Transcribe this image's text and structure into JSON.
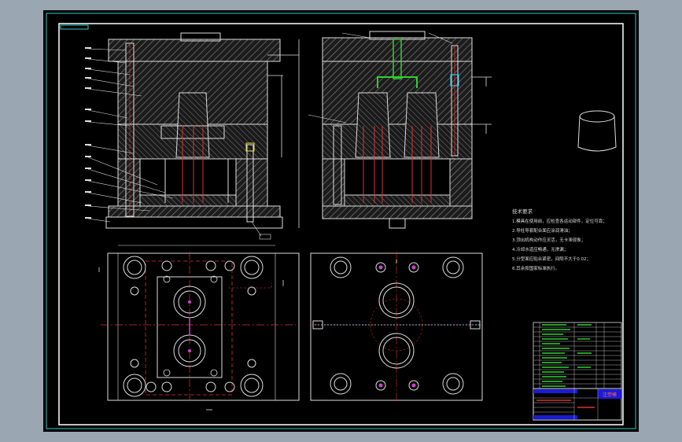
{
  "colors": {
    "outer": "#9aa6b1",
    "sheet": "#000000",
    "border": "#ffffff",
    "frame_cyan": "#35c8c8",
    "hatch": "#9a9a9a",
    "red": "#e03030",
    "green": "#30d030",
    "yellow": "#e8e030",
    "cyan": "#30c0e0",
    "magenta": "#d040d0",
    "blue_block": "#1a1ad8"
  },
  "drawing": {
    "tech_notes": [
      "技术要求",
      "1.模具在使用前，应检查各运动部件，定位可靠；",
      "2.导柱导套配合面应涂润滑油；",
      "3.顶出机构动作应灵活，无卡滞现象；",
      "4.冷却水道应畅通，无渗漏；",
      "5.分型面应贴合紧密，间隙不大于0.02；",
      "6.其余按国家标准执行。"
    ],
    "title_block_label": "注塑模"
  },
  "icons": {
    "product": "cup-shaped-plastic-part-icon"
  }
}
